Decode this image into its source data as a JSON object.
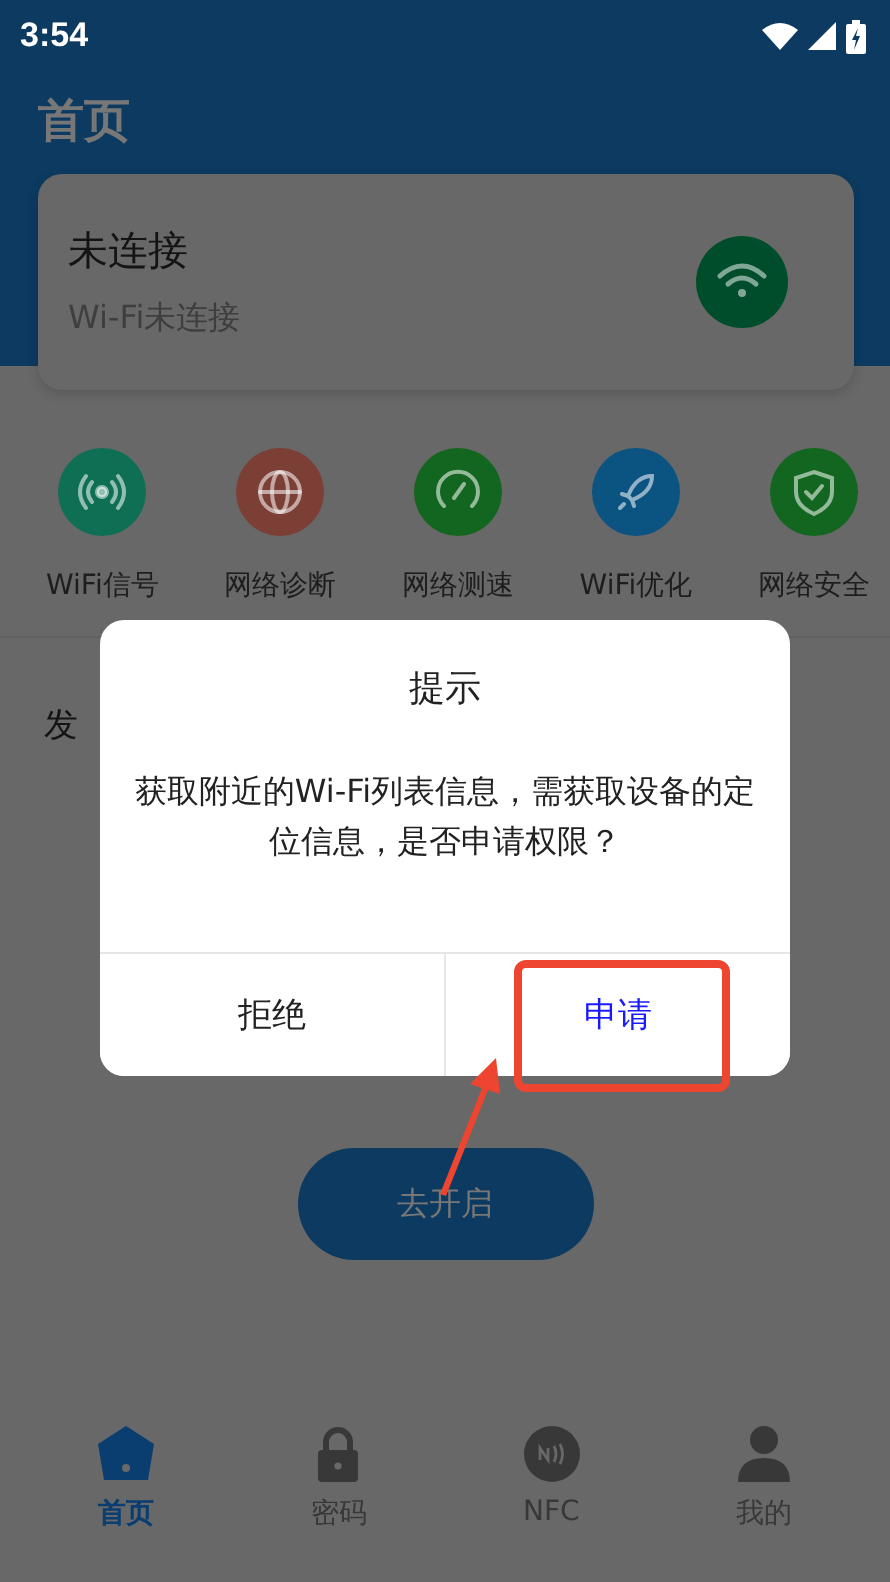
{
  "status_bar": {
    "time": "3:54"
  },
  "header": {
    "title": "首页"
  },
  "connection_card": {
    "title": "未连接",
    "subtitle": "Wi-Fi未连接"
  },
  "features": [
    {
      "label": "WiFi信号",
      "color": "#0f6f55"
    },
    {
      "label": "网络诊断",
      "color": "#7b3f35"
    },
    {
      "label": "网络测速",
      "color": "#12661f"
    },
    {
      "label": "WiFi优化",
      "color": "#0b5380"
    },
    {
      "label": "网络安全",
      "color": "#12661f"
    }
  ],
  "section": {
    "title": "发"
  },
  "open_button": {
    "label": "去开启"
  },
  "bottom_nav": [
    {
      "label": "首页",
      "selected": true
    },
    {
      "label": "密码",
      "selected": false
    },
    {
      "label": "NFC",
      "selected": false
    },
    {
      "label": "我的",
      "selected": false
    }
  ],
  "dialog": {
    "title": "提示",
    "message": "获取附近的Wi-Fi列表信息，需获取设备的定位信息，是否申请权限？",
    "buttons": [
      {
        "label": "拒绝",
        "kind": "negative"
      },
      {
        "label": "申请",
        "kind": "positive"
      }
    ]
  }
}
